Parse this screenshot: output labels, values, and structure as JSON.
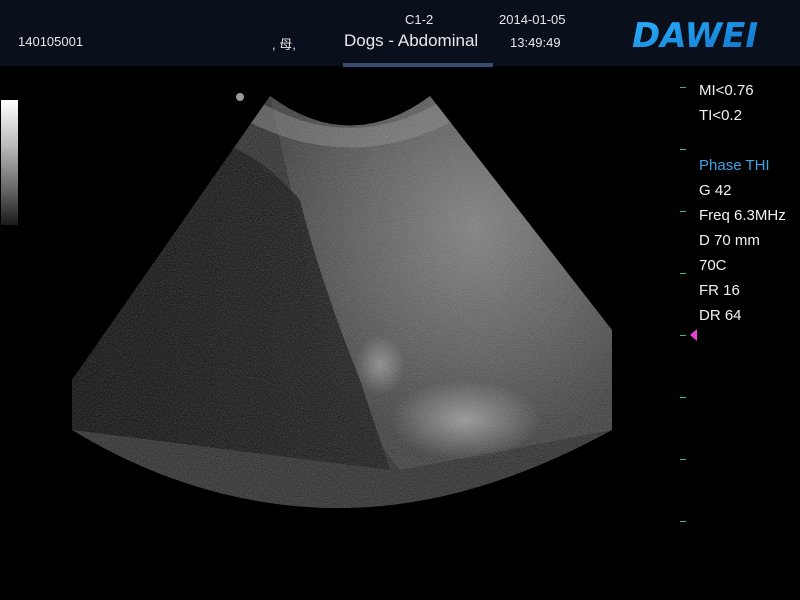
{
  "header": {
    "patient_id": "140105001",
    "patient_name": ", 母,",
    "exam_type": "Dogs - Abdominal",
    "probe": "C1-2",
    "date": "2014-01-05",
    "time": "13:49:49",
    "brand": "DAWEI",
    "brand_color": "#1a8fe0"
  },
  "parameters": {
    "mi": "MI<0.76",
    "ti": "TI<0.2",
    "mode": "Phase THI",
    "gain": "G 42",
    "freq": "Freq 6.3MHz",
    "depth": "D 70 mm",
    "preset": "70C",
    "frame_rate": "FR 16",
    "dynamic_range": "DR 64"
  },
  "colors": {
    "accent": "#3ea4e6",
    "tick": "#2ec07a",
    "focus_marker": "#e63fd6",
    "header_bg": "#0a0f1c"
  }
}
